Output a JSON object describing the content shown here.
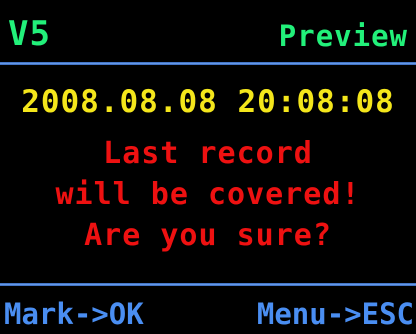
{
  "colors": {
    "background": "#000000",
    "green": "#22f07a",
    "yellow": "#f4e61b",
    "red": "#ee1111",
    "blue": "#4a8ef2",
    "divider": "#6fa2f0"
  },
  "header": {
    "mode_label": "V5",
    "status_label": "Preview"
  },
  "main": {
    "datetime": "2008.08.08 20:08:08",
    "message_lines": [
      "Last record",
      "will be covered!",
      "Are you sure?"
    ]
  },
  "footer": {
    "left_hint": "Mark->OK",
    "right_hint": "Menu->ESC"
  }
}
